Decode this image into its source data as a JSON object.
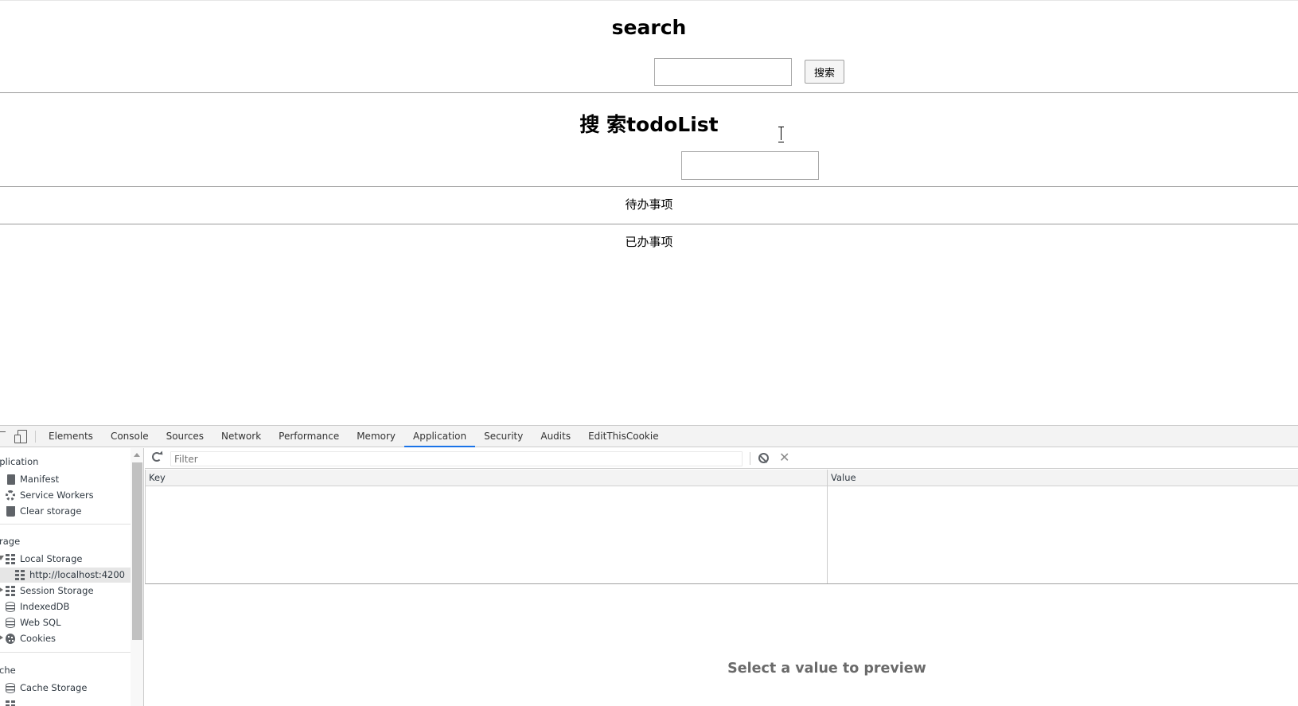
{
  "page": {
    "search_title": "search",
    "search_button": "搜索",
    "todo_title": "搜 索todoList",
    "pending_label": "待办事项",
    "done_label": "已办事项"
  },
  "devtools": {
    "tabs": [
      "Elements",
      "Console",
      "Sources",
      "Network",
      "Performance",
      "Memory",
      "Application",
      "Security",
      "Audits",
      "EditThisCookie"
    ],
    "active_tab": "Application",
    "sidebar": {
      "section_application": "pplication",
      "manifest": "Manifest",
      "service_workers": "Service Workers",
      "clear_storage": "Clear storage",
      "section_storage": "orage",
      "local_storage": "Local Storage",
      "local_storage_origin": "http://localhost:4200",
      "session_storage": "Session Storage",
      "indexeddb": "IndexedDB",
      "web_sql": "Web SQL",
      "cookies": "Cookies",
      "section_cache": "ache",
      "cache_storage": "Cache Storage"
    },
    "toolbar": {
      "filter_placeholder": "Filter",
      "close_glyph": "✕"
    },
    "grid": {
      "key_header": "Key",
      "value_header": "Value"
    },
    "preview_text": "Select a value to preview"
  }
}
